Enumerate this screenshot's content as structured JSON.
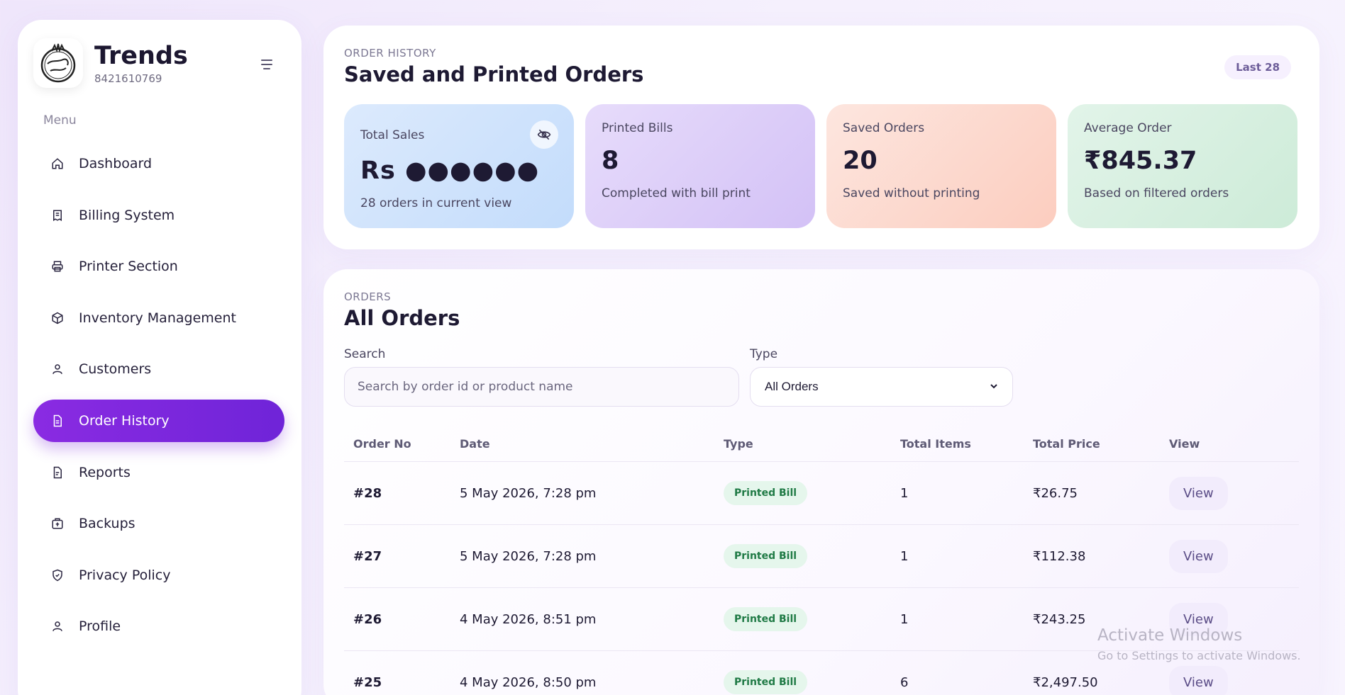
{
  "brand": {
    "name": "Trends",
    "phone": "8421610769"
  },
  "sidebar": {
    "menu_label": "Menu",
    "items": [
      {
        "label": "Dashboard",
        "icon": "home-icon"
      },
      {
        "label": "Billing System",
        "icon": "receipt-icon"
      },
      {
        "label": "Printer Section",
        "icon": "printer-icon"
      },
      {
        "label": "Inventory Management",
        "icon": "box-icon"
      },
      {
        "label": "Customers",
        "icon": "user-icon"
      },
      {
        "label": "Order History",
        "icon": "document-icon",
        "active": true
      },
      {
        "label": "Reports",
        "icon": "report-icon"
      },
      {
        "label": "Backups",
        "icon": "backup-icon"
      },
      {
        "label": "Privacy Policy",
        "icon": "shield-icon"
      },
      {
        "label": "Profile",
        "icon": "profile-icon"
      }
    ]
  },
  "summary": {
    "eyebrow": "ORDER HISTORY",
    "title": "Saved and Printed Orders",
    "badge": "Last 28",
    "cards": [
      {
        "label": "Total Sales",
        "value": "Rs ●●●●●●",
        "sub": "28 orders in current view"
      },
      {
        "label": "Printed Bills",
        "value": "8",
        "sub": "Completed with bill print"
      },
      {
        "label": "Saved Orders",
        "value": "20",
        "sub": "Saved without printing"
      },
      {
        "label": "Average Order",
        "value": "₹845.37",
        "sub": "Based on filtered orders"
      }
    ]
  },
  "orders": {
    "eyebrow": "ORDERS",
    "title": "All Orders",
    "search_label": "Search",
    "search_placeholder": "Search by order id or product name",
    "type_label": "Type",
    "type_value": "All Orders",
    "columns": [
      "Order No",
      "Date",
      "Type",
      "Total Items",
      "Total Price",
      "View"
    ],
    "rows": [
      {
        "no": "#28",
        "date": "5 May 2026, 7:28 pm",
        "type": "Printed Bill",
        "items": "1",
        "price": "₹26.75",
        "view": "View"
      },
      {
        "no": "#27",
        "date": "5 May 2026, 7:28 pm",
        "type": "Printed Bill",
        "items": "1",
        "price": "₹112.38",
        "view": "View"
      },
      {
        "no": "#26",
        "date": "4 May 2026, 8:51 pm",
        "type": "Printed Bill",
        "items": "1",
        "price": "₹243.25",
        "view": "View"
      },
      {
        "no": "#25",
        "date": "4 May 2026, 8:50 pm",
        "type": "Printed Bill",
        "items": "6",
        "price": "₹2,497.50",
        "view": "View"
      }
    ]
  },
  "watermark": {
    "title": "Activate Windows",
    "sub": "Go to Settings to activate Windows."
  },
  "colors": {
    "accent": "#7b27dd",
    "printed_pill_bg": "#e5f6ec",
    "printed_pill_text": "#1f7a45"
  }
}
